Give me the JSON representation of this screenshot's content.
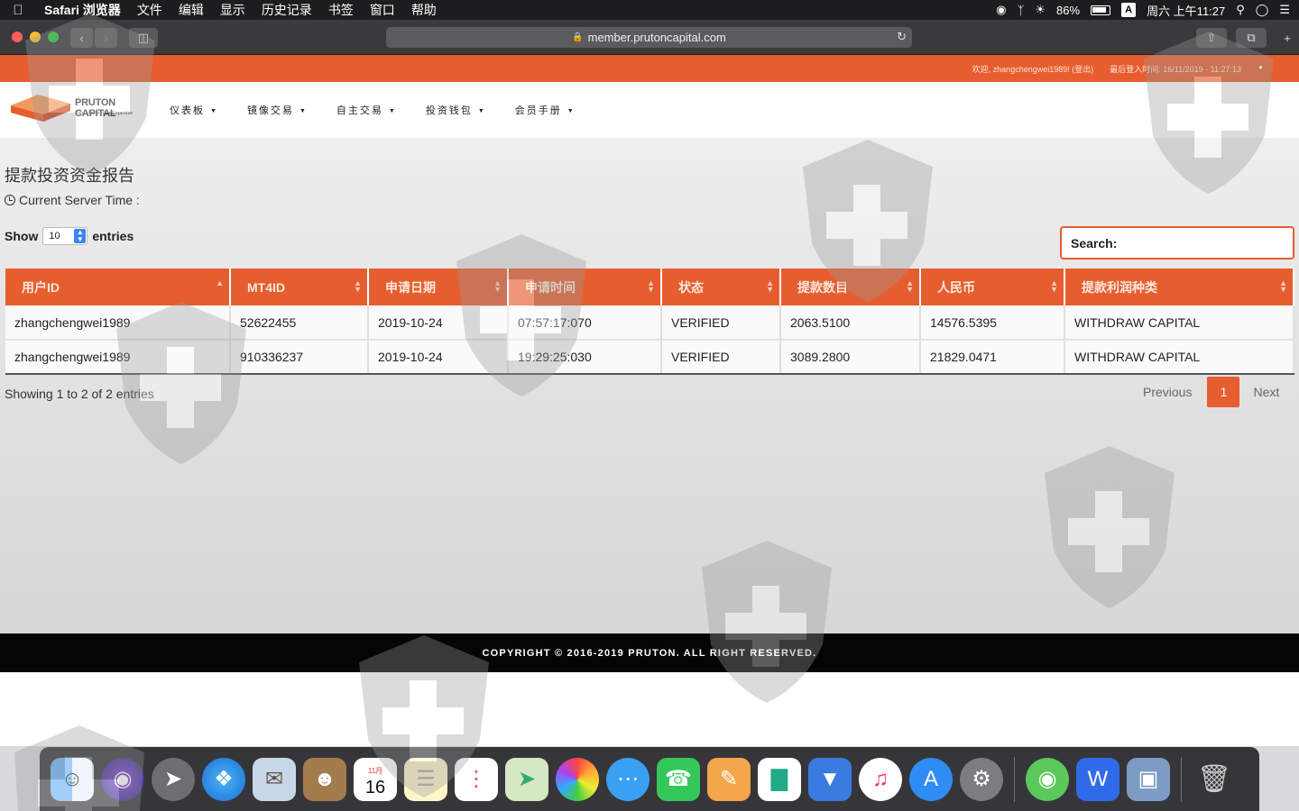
{
  "menubar": {
    "app_name": "Safari 浏览器",
    "items": [
      "文件",
      "编辑",
      "显示",
      "历史记录",
      "书签",
      "窗口",
      "帮助"
    ],
    "battery": "86%",
    "input_method": "A",
    "clock": "周六 上午11:27"
  },
  "browser": {
    "url": "member.prutoncapital.com"
  },
  "topstrip": {
    "welcome": "欢迎, zhangchengwei1989! (登出)",
    "last_login": "最后登入时间: 16/11/2019 - 11:27:13"
  },
  "logo": {
    "name": "PRUTON CAPITAL",
    "tagline": "Your Vision. Our Expertise"
  },
  "nav": {
    "items": [
      "仪表板",
      "镜像交易",
      "自主交易",
      "投资钱包",
      "会员手册"
    ]
  },
  "report": {
    "title": "提款投资资金报告",
    "server_time": "Current Server Time :"
  },
  "table_controls": {
    "show_label": "Show",
    "entries_value": "10",
    "entries_label": "entries",
    "search_label": "Search:"
  },
  "table": {
    "columns": [
      "用户ID",
      "MT4ID",
      "申请日期",
      "申请时间",
      "状态",
      "提款数目",
      "人民币",
      "提款利润种类"
    ],
    "rows": [
      [
        "zhangchengwei1989",
        "52622455",
        "2019-10-24",
        "07:57:17:070",
        "VERIFIED",
        "2063.5100",
        "14576.5395",
        "WITHDRAW CAPITAL"
      ],
      [
        "zhangchengwei1989",
        "910336237",
        "2019-10-24",
        "19:29:25:030",
        "VERIFIED",
        "3089.2800",
        "21829.0471",
        "WITHDRAW CAPITAL"
      ]
    ]
  },
  "pagination": {
    "info": "Showing 1 to 2 of 2 entries",
    "previous": "Previous",
    "current": "1",
    "next": "Next"
  },
  "footer": {
    "copyright": "COPYRIGHT © 2016-2019 PRUTON. ALL RIGHT RESERVED."
  },
  "dock": {
    "calendar_month": "11月",
    "calendar_day": "16"
  },
  "colors": {
    "accent": "#e65e2f",
    "footer": "#050505"
  }
}
